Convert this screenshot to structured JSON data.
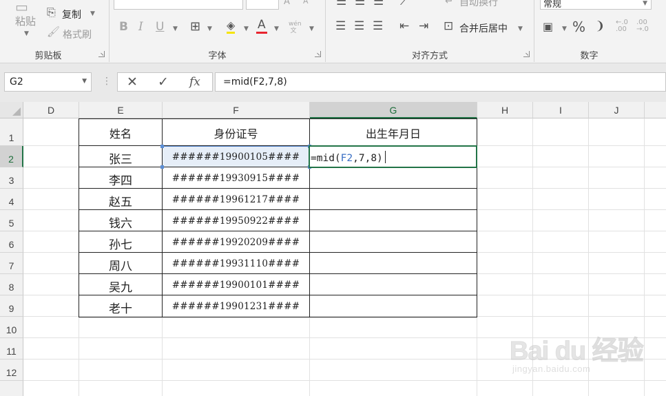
{
  "ribbon": {
    "clipboard": {
      "paste_label": "粘贴",
      "copy_label": "复制",
      "format_painter_label": "格式刷",
      "group_label": "剪贴板"
    },
    "font": {
      "group_label": "字体",
      "bold": "B",
      "italic": "I",
      "underline": "U",
      "phonetic": "wén 文"
    },
    "alignment": {
      "wrap_text_label": "自动换行",
      "merge_center_label": "合并后居中",
      "group_label": "对齐方式"
    },
    "number": {
      "format_value": "常规",
      "percent": "%",
      "comma": "❩",
      "group_label": "数字"
    }
  },
  "formula_bar": {
    "name_box": "G2",
    "cancel_icon": "✕",
    "enter_icon": "✓",
    "fx_label": "fx",
    "formula": "=mid(F2,7,8)"
  },
  "columns": [
    "D",
    "E",
    "F",
    "G",
    "H",
    "I",
    "J"
  ],
  "rows": [
    "1",
    "2",
    "3",
    "4",
    "5",
    "6",
    "7",
    "8",
    "9",
    "10",
    "11",
    "12"
  ],
  "table": {
    "headers": {
      "name": "姓名",
      "id": "身份证号",
      "birth": "出生年月日"
    },
    "records": [
      {
        "name": "张三",
        "id": "######19900105####"
      },
      {
        "name": "李四",
        "id": "######19930915####"
      },
      {
        "name": "赵五",
        "id": "######19961217####"
      },
      {
        "name": "钱六",
        "id": "######19950922####"
      },
      {
        "name": "孙七",
        "id": "######19920209####"
      },
      {
        "name": "周八",
        "id": "######19931110####"
      },
      {
        "name": "吴九",
        "id": "######19900101####"
      },
      {
        "name": "老十",
        "id": "######19901231####"
      }
    ],
    "editing_cell": {
      "eq": "=mid(",
      "ref": "F2",
      "rest": ",7,8)"
    }
  },
  "watermark": {
    "brand": "Bai du 经验",
    "url": "jingyan.baidu.com"
  },
  "colors": {
    "excel_green": "#217346",
    "selection_blue": "#5b8ed6",
    "ref_blue": "#3a6fc4"
  }
}
